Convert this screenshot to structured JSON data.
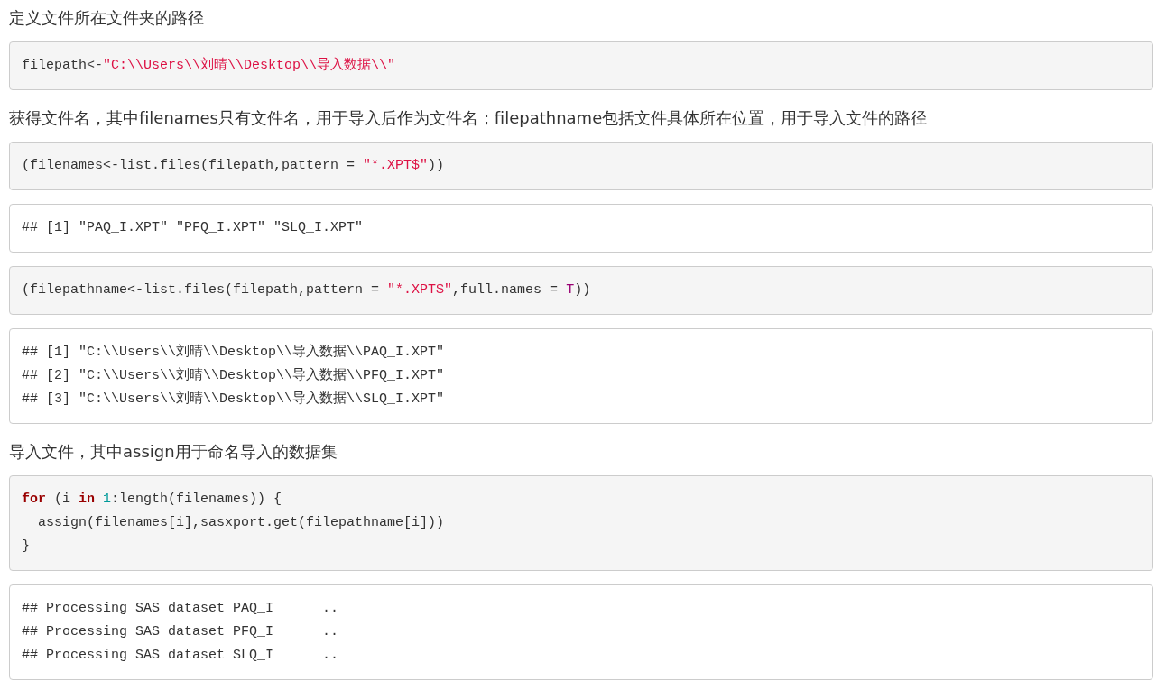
{
  "blocks": [
    {
      "kind": "text",
      "text": "定义文件所在文件夹的路径"
    },
    {
      "kind": "code",
      "lines": [
        [
          {
            "text": "filepath<-",
            "kind": "plain"
          },
          {
            "text": "\"C:\\\\Users\\\\刘晴\\\\Desktop\\\\导入数据\\\\\"",
            "kind": "string"
          }
        ]
      ]
    },
    {
      "kind": "text",
      "text": "获得文件名，其中filenames只有文件名，用于导入后作为文件名；filepathname包括文件具体所在位置，用于导入文件的路径"
    },
    {
      "kind": "code",
      "lines": [
        [
          {
            "text": "(filenames<-list.files(filepath,pattern = ",
            "kind": "plain"
          },
          {
            "text": "\"*.XPT$\"",
            "kind": "string"
          },
          {
            "text": "))",
            "kind": "plain"
          }
        ]
      ]
    },
    {
      "kind": "output",
      "lines": [
        [
          {
            "text": "## [1] \"PAQ_I.XPT\" \"PFQ_I.XPT\" \"SLQ_I.XPT\"",
            "kind": "plain"
          }
        ]
      ]
    },
    {
      "kind": "code",
      "lines": [
        [
          {
            "text": "(filepathname<-list.files(filepath,pattern = ",
            "kind": "plain"
          },
          {
            "text": "\"*.XPT$\"",
            "kind": "string"
          },
          {
            "text": ",full.names = ",
            "kind": "plain"
          },
          {
            "text": "T",
            "kind": "constant"
          },
          {
            "text": "))",
            "kind": "plain"
          }
        ]
      ]
    },
    {
      "kind": "output",
      "lines": [
        [
          {
            "text": "## [1] \"C:\\\\Users\\\\刘晴\\\\Desktop\\\\导入数据\\\\PAQ_I.XPT\"",
            "kind": "plain"
          }
        ],
        [
          {
            "text": "## [2] \"C:\\\\Users\\\\刘晴\\\\Desktop\\\\导入数据\\\\PFQ_I.XPT\"",
            "kind": "plain"
          }
        ],
        [
          {
            "text": "## [3] \"C:\\\\Users\\\\刘晴\\\\Desktop\\\\导入数据\\\\SLQ_I.XPT\"",
            "kind": "plain"
          }
        ]
      ]
    },
    {
      "kind": "text",
      "text": "导入文件，其中assign用于命名导入的数据集"
    },
    {
      "kind": "code",
      "lines": [
        [
          {
            "text": "for",
            "kind": "keyword"
          },
          {
            "text": " (i ",
            "kind": "plain"
          },
          {
            "text": "in",
            "kind": "keyword"
          },
          {
            "text": " 1",
            "kind": "number"
          },
          {
            "text": ":length(filenames)) {",
            "kind": "plain"
          }
        ],
        [
          {
            "text": "  assign(filenames[i],sasxport.get(filepathname[i]))",
            "kind": "plain"
          }
        ],
        [
          {
            "text": "}",
            "kind": "plain"
          }
        ]
      ]
    },
    {
      "kind": "output",
      "lines": [
        [
          {
            "text": "## Processing SAS dataset PAQ_I      ..",
            "kind": "plain"
          }
        ],
        [
          {
            "text": "## Processing SAS dataset PFQ_I      ..",
            "kind": "plain"
          }
        ],
        [
          {
            "text": "## Processing SAS dataset SLQ_I      ..",
            "kind": "plain"
          }
        ]
      ]
    }
  ]
}
